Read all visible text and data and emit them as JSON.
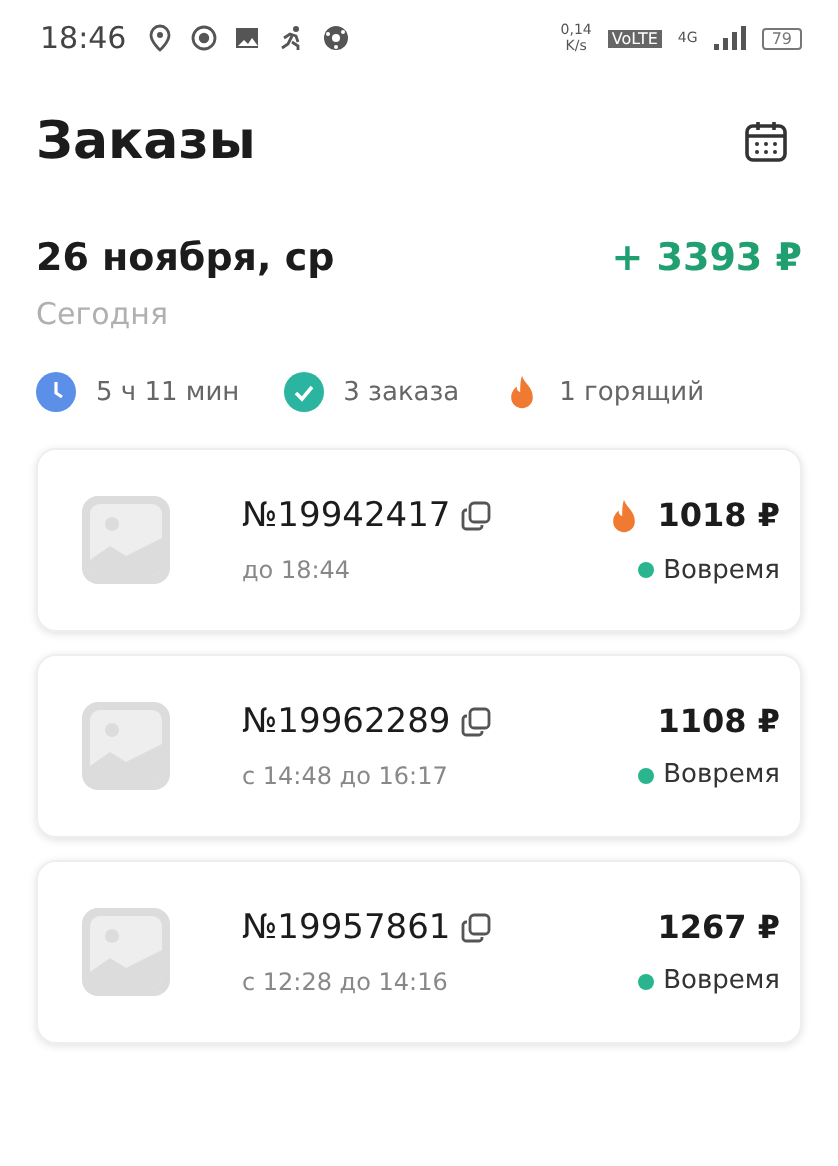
{
  "status_bar": {
    "time": "18:46",
    "net_speed": "0,14",
    "net_unit": "K/s",
    "volte": "VoLTE",
    "network": "4G",
    "battery": "79"
  },
  "header": {
    "title": "Заказы"
  },
  "day": {
    "date": "26 ноября, ср",
    "total": "+ 3393 ₽",
    "subtitle": "Сегодня"
  },
  "stats": [
    {
      "kind": "time",
      "label": "5 ч 11 мин"
    },
    {
      "kind": "orders",
      "label": "3 заказа"
    },
    {
      "kind": "hot",
      "label": "1 горящий"
    }
  ],
  "orders": [
    {
      "number": "№19942417",
      "time": "до 18:44",
      "price": "1018 ₽",
      "hot": true,
      "status": "Вовремя",
      "color": "#2bb58f"
    },
    {
      "number": "№19962289",
      "time": "с 14:48 до 16:17",
      "price": "1108 ₽",
      "hot": false,
      "status": "Вовремя",
      "color": "#2bb58f"
    },
    {
      "number": "№19957861",
      "time": "с 12:28 до 14:16",
      "price": "1267 ₽",
      "hot": false,
      "status": "Вовремя",
      "color": "#2bb58f"
    }
  ]
}
